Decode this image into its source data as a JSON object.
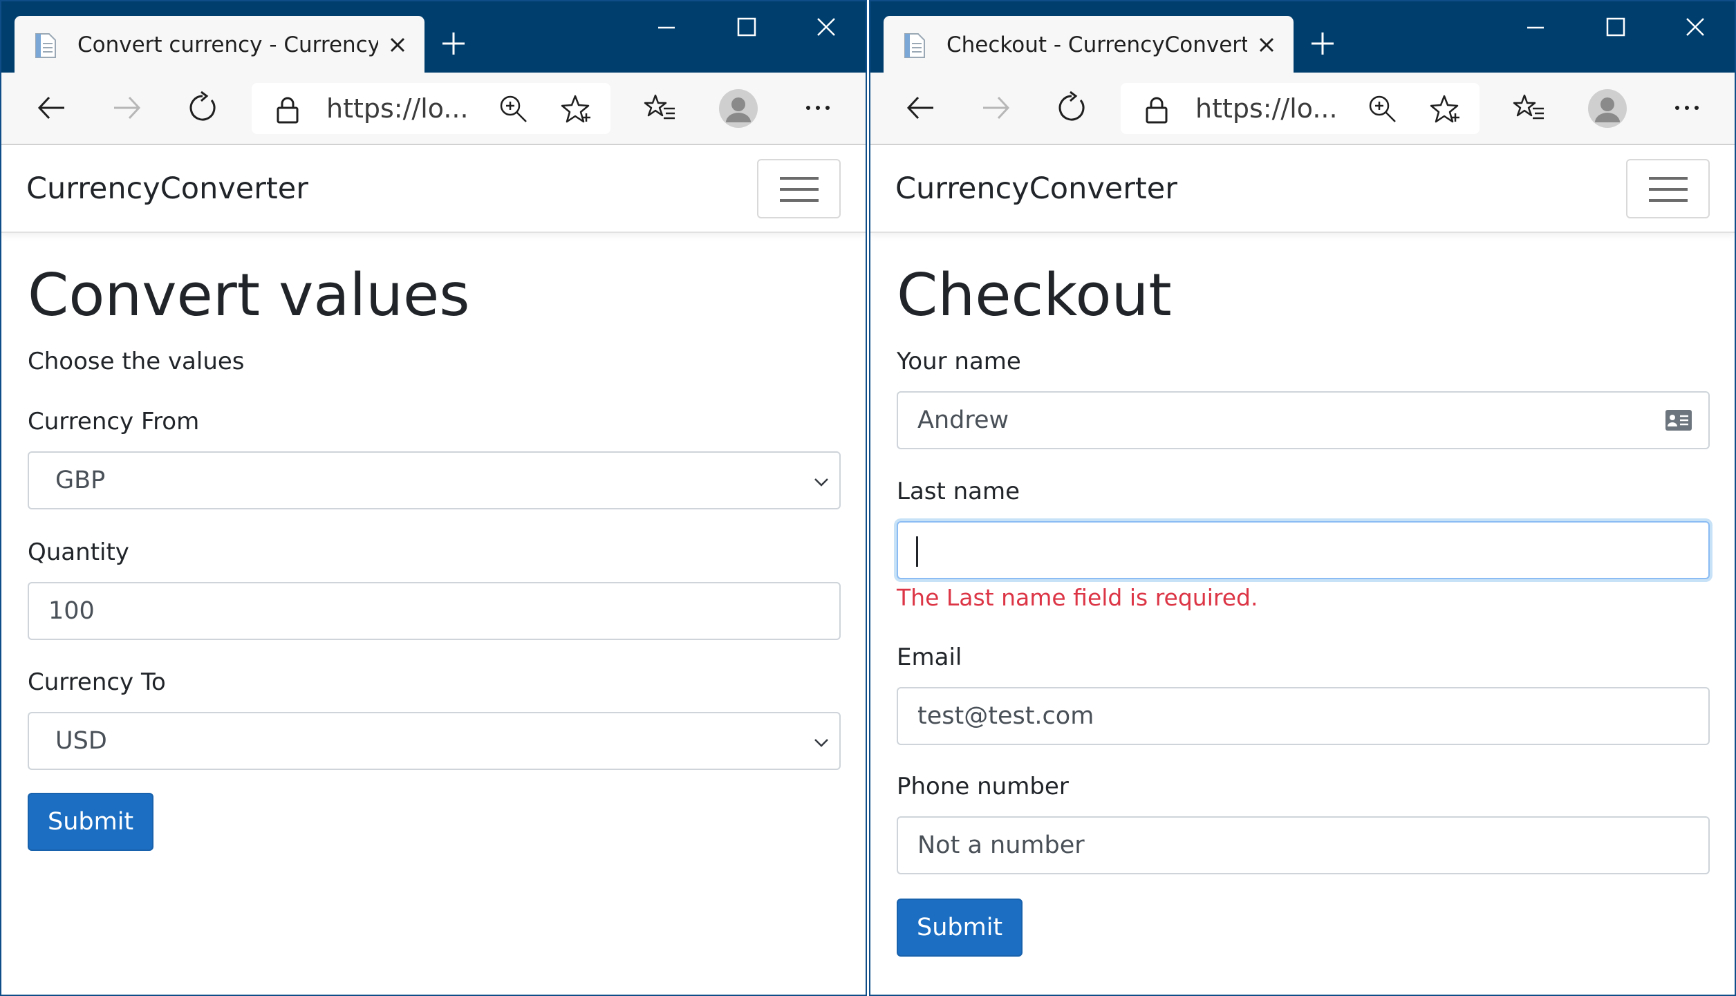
{
  "left_window": {
    "tab_title": "Convert currency - CurrencyConverter",
    "address_text": "https://lo...",
    "brand": "CurrencyConverter",
    "page_title": "Convert values",
    "subtitle": "Choose the values",
    "currency_from": {
      "label": "Currency From",
      "value": "GBP"
    },
    "quantity": {
      "label": "Quantity",
      "value": "100"
    },
    "currency_to": {
      "label": "Currency To",
      "value": "USD"
    },
    "submit_label": "Submit"
  },
  "right_window": {
    "tab_title": "Checkout - CurrencyConverter",
    "address_text": "https://lo...",
    "brand": "CurrencyConverter",
    "page_title": "Checkout",
    "your_name": {
      "label": "Your name",
      "value": "Andrew"
    },
    "last_name": {
      "label": "Last name",
      "value": "",
      "error": "The Last name field is required."
    },
    "email": {
      "label": "Email",
      "value": "test@test.com"
    },
    "phone": {
      "label": "Phone number",
      "value": "Not a number"
    },
    "submit_label": "Submit"
  },
  "icons": {
    "favicon": "page-icon",
    "close": "close-icon",
    "new_tab": "plus-icon",
    "minimize": "minimize-icon",
    "maximize": "maximize-icon",
    "window_close": "window-close-icon",
    "back": "back-arrow-icon",
    "forward": "forward-arrow-icon",
    "refresh": "refresh-icon",
    "lock": "lock-icon",
    "zoom": "zoom-in-icon",
    "favorite": "star-icon",
    "favorites": "favorites-list-icon",
    "profile": "avatar-icon",
    "more": "more-icon",
    "menu": "hamburger-icon",
    "dropdown": "chevron-down-icon",
    "contact": "contact-card-icon"
  },
  "colors": {
    "titlebar": "#003e6e",
    "primary_button": "#1b6ec2",
    "error": "#dc3545",
    "focus_ring": "#8bbcf3"
  }
}
